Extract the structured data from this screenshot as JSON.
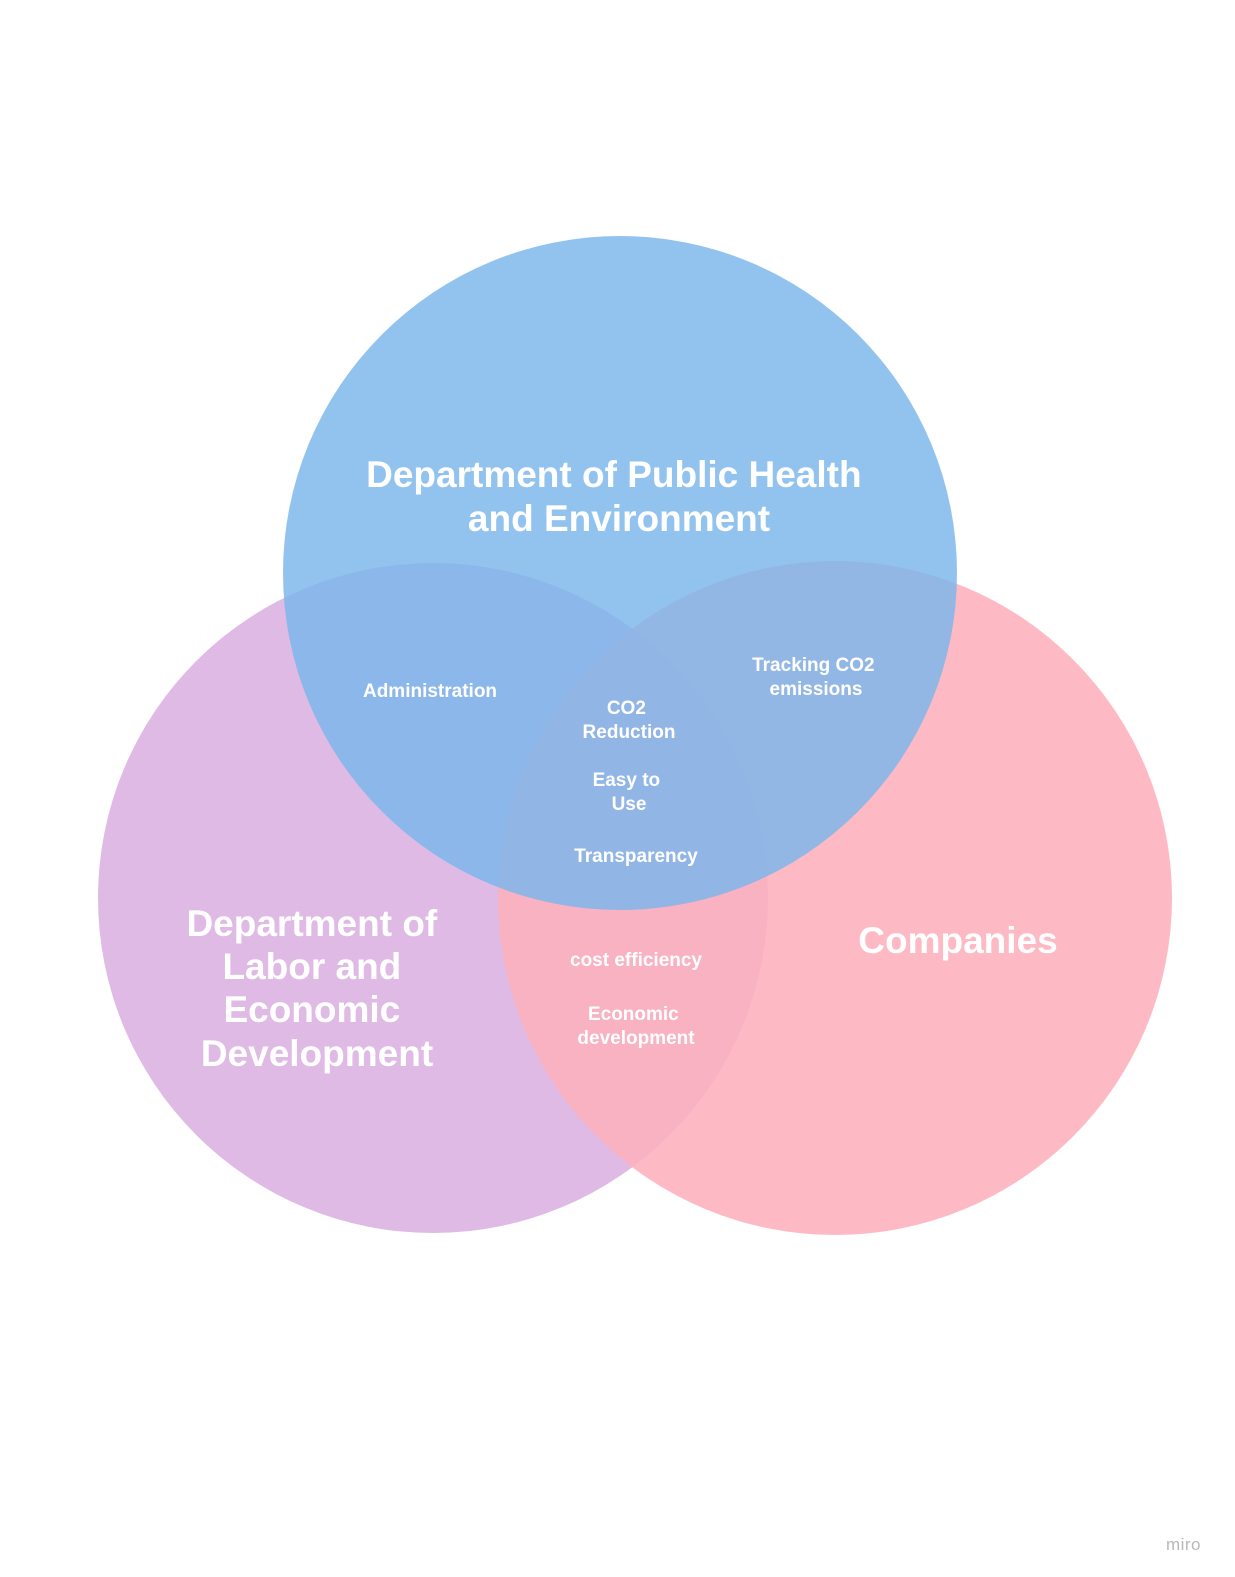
{
  "circles": {
    "top": {
      "label": "Department of Public Health and Environment",
      "label_lines": [
        "Department of Public Health",
        "and Environment"
      ],
      "color": "#7AB6EC"
    },
    "left": {
      "label": "Department of Labor and Economic Development",
      "label_lines": [
        "Department of",
        "Labor and",
        "Economic",
        "Development"
      ],
      "color": "#D9AEE0"
    },
    "right": {
      "label": "Companies",
      "label_lines": [
        "Companies"
      ],
      "color": "#FDB1BC"
    }
  },
  "overlaps": {
    "top_left": {
      "items": [
        [
          "Administration"
        ]
      ]
    },
    "top_right": {
      "items": [
        [
          "Tracking CO2",
          "emissions"
        ]
      ]
    },
    "center": {
      "items": [
        [
          "CO2",
          "Reduction"
        ],
        [
          "Easy to",
          "Use"
        ],
        [
          "Transparency"
        ]
      ]
    },
    "left_right": {
      "items": [
        [
          "cost efficiency"
        ],
        [
          "Economic",
          "development"
        ]
      ]
    }
  },
  "watermark": "miro"
}
